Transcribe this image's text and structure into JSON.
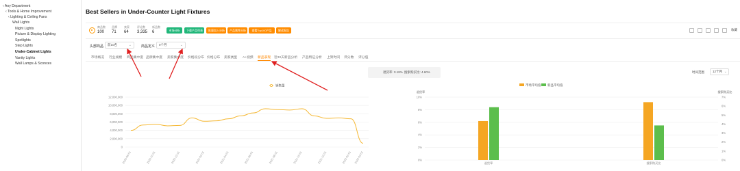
{
  "sidebar": {
    "items": [
      {
        "label": "‹ Any Department"
      },
      {
        "label": "‹ Tools & Home Improvement"
      },
      {
        "label": "‹ Lighting & Ceiling Fans"
      },
      {
        "label": "Wall Lights"
      },
      {
        "label": "Night Lights"
      },
      {
        "label": "Picture & Display Lighting"
      },
      {
        "label": "Spotlights"
      },
      {
        "label": "Step Lights"
      },
      {
        "label": "Under-Cabinet Lights"
      },
      {
        "label": "Vanity Lights"
      },
      {
        "label": "Wall Lamps & Sconces"
      }
    ]
  },
  "page": {
    "title": "Best Sellers in Under-Counter Light Fixtures"
  },
  "stats": [
    {
      "label": "商品数",
      "value": "100"
    },
    {
      "label": "品牌",
      "value": "71"
    },
    {
      "label": "卖家",
      "value": "64"
    },
    {
      "label": "评论数",
      "value": "3,335"
    },
    {
      "label": "新品数",
      "value": "6"
    }
  ],
  "tags": [
    {
      "label": "市场分析",
      "color": "#21b77a"
    },
    {
      "label": "下载产品列表",
      "color": "#21b77a"
    },
    {
      "label": "批量加入分析",
      "color": "#ff8c00"
    },
    {
      "label": "产品属性分析",
      "color": "#ff8c00"
    },
    {
      "label": "查看Top100产品",
      "color": "#ff8c00"
    },
    {
      "label": "解读报告",
      "color": "#ff8c00"
    }
  ],
  "toolbar": {
    "collect_label": "收藏"
  },
  "filters": {
    "top_label": "头部商品",
    "top_value": "前10名",
    "weight_label": "商品定义",
    "weight_value": "0个月"
  },
  "tabs": [
    {
      "label": "市场概况"
    },
    {
      "label": "行业规模"
    },
    {
      "label": "商品集中度"
    },
    {
      "label": "品牌集中度"
    },
    {
      "label": "卖家集中度"
    },
    {
      "label": "价格段分布"
    },
    {
      "label": "价格分布"
    },
    {
      "label": "卖家类型"
    },
    {
      "label": "A+视频"
    },
    {
      "label": "新品表现"
    },
    {
      "label": "近30天新品分析"
    },
    {
      "label": "产品特征分析"
    },
    {
      "label": "上架时间"
    },
    {
      "label": "评分数"
    },
    {
      "label": "评分值"
    }
  ],
  "active_tab_index": 9,
  "metrics": {
    "left": "退货率: 0.18%",
    "right": "搜索购买比: 4.60%"
  },
  "range": {
    "label": "时间范围",
    "value": "12个月"
  },
  "chart_data": [
    {
      "type": "line",
      "series": [
        {
          "name": "销售量",
          "color": "#f5b731",
          "values": [
            4000000,
            5300000,
            5500000,
            5100000,
            5200000,
            7000000,
            6200000,
            6300000,
            6800000,
            7500000,
            8200000,
            9200000,
            9000000,
            8900000,
            9200000,
            7500000,
            6900000,
            7000000,
            6800000,
            900000
          ]
        }
      ],
      "x": [
        "2020-08-01",
        "2020-09-01",
        "2020-10-01",
        "2020-11-01",
        "2020-12-01",
        "2021-01-01",
        "2021-02-01",
        "2021-03-01",
        "2021-04-01",
        "2021-05-01",
        "2021-06-01",
        "2021-07-01",
        "2021-08-01",
        "2021-09-01",
        "2021-10-01",
        "2021-11-01",
        "2021-12-01",
        "2022-01-01",
        "2022-02-01",
        "2022-03-01"
      ],
      "xticks": [
        "2020-08-01",
        "2020-10-01",
        "2020-12-01",
        "2021-02-01",
        "2021-04-01",
        "2021-06-01",
        "2021-08-01",
        "2021-10-01",
        "2021-12-01",
        "2022-02-01",
        "2022-03-01"
      ],
      "yticks": [
        "0",
        "2,000,000",
        "4,000,000",
        "6,000,000",
        "8,000,000",
        "10,000,000",
        "12,000,000"
      ],
      "ylim": [
        0,
        12000000
      ],
      "grid": true,
      "legend": "top-center"
    },
    {
      "type": "bar",
      "categories": [
        "退货率",
        "搜索购买比"
      ],
      "series": [
        {
          "name": "市场平均值",
          "color": "#f5a623",
          "values": [
            6.2,
            9.2
          ]
        },
        {
          "name": "新品平均值",
          "color": "#5cbe4c",
          "values": [
            8.4,
            5.5
          ]
        }
      ],
      "left_axis_label": "退货率",
      "right_axis_label": "搜索购买比",
      "yticks_left": [
        "0%",
        "2%",
        "4%",
        "6%",
        "8%",
        "10%"
      ],
      "yticks_right": [
        "0%",
        "1%",
        "2%",
        "3%",
        "4%",
        "5%",
        "6%",
        "7%"
      ],
      "ylim": [
        0,
        10
      ],
      "grid": true,
      "legend": "top-center"
    }
  ]
}
